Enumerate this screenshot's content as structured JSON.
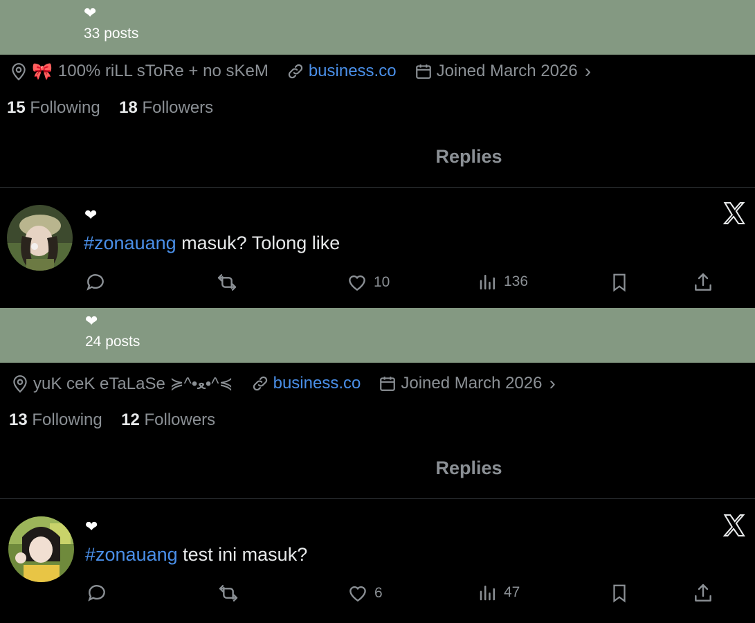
{
  "panels": [
    {
      "header": {
        "heart": "❤",
        "posts": "33 posts"
      },
      "meta": {
        "location_icon": "location-pin-icon",
        "bio_emoji": "🎀",
        "location": "100% riLL sToRe + no sKeM",
        "link_icon": "link-icon",
        "link": "business.co",
        "calendar_icon": "calendar-icon",
        "joined": "Joined March 2026",
        "chevron": "›"
      },
      "follow": {
        "following_count": "15",
        "following_label": "Following",
        "followers_count": "18",
        "followers_label": "Followers"
      },
      "tab": "Replies",
      "post": {
        "heart": "❤",
        "hashtag": "#zonauang",
        "text": " masuk? Tolong like",
        "actions": {
          "reply": "",
          "repost": "",
          "likes": "10",
          "views": "136"
        }
      }
    },
    {
      "header": {
        "heart": "❤",
        "posts": "24 posts"
      },
      "meta": {
        "location_icon": "location-pin-icon",
        "location": "yuK ceK eTaLaSe ≽^•ﻌ•^≼",
        "link_icon": "link-icon",
        "link": "business.co",
        "calendar_icon": "calendar-icon",
        "joined": "Joined March 2026",
        "chevron": "›"
      },
      "follow": {
        "following_count": "13",
        "following_label": "Following",
        "followers_count": "12",
        "followers_label": "Followers"
      },
      "tab": "Replies",
      "post": {
        "heart": "❤",
        "hashtag": "#zonauang",
        "text": " test ini masuk?",
        "actions": {
          "reply": "",
          "repost": "",
          "likes": "6",
          "views": "47"
        }
      }
    }
  ],
  "colors": {
    "header_band": "#849982",
    "link": "#4a8fe8",
    "muted": "#8b9095",
    "text": "#e7e9ea"
  }
}
